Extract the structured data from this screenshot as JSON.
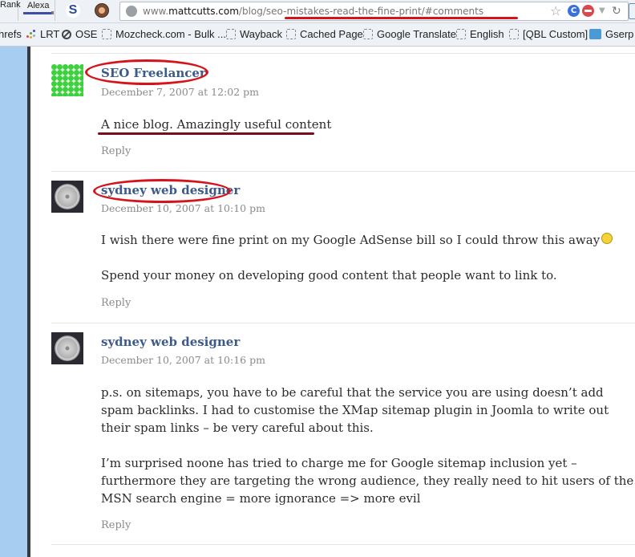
{
  "browser": {
    "extensions": {
      "rank_label": "Rank",
      "alexa_label": "Alexa",
      "s_icon_label": "S"
    },
    "url": {
      "prefix": "www.",
      "domain": "mattcutts.com",
      "path": "/blog/seo-mistakes-read-the-fine-print/#comments"
    },
    "g_icon_label": "C",
    "bookmarks": [
      {
        "label": "hrefs",
        "icon": "none"
      },
      {
        "label": "LRT",
        "icon": "lrt-icon"
      },
      {
        "label": "OSE",
        "icon": "ose-icon"
      },
      {
        "label": "Mozcheck.com - Bulk ...",
        "icon": "folder-icon"
      },
      {
        "label": "Wayback",
        "icon": "folder-icon"
      },
      {
        "label": "Cached Page",
        "icon": "folder-icon"
      },
      {
        "label": "Google Translate",
        "icon": "folder-icon"
      },
      {
        "label": "English",
        "icon": "folder-icon"
      },
      {
        "label": "[QBL Custom]",
        "icon": "folder-icon"
      },
      {
        "label": "Gserp",
        "icon": "gserp-icon"
      }
    ]
  },
  "comments": [
    {
      "author": "SEO Freelancer",
      "date": "December 7, 2007 at 12:02 pm",
      "paragraphs": [
        "A nice blog. Amazingly useful content"
      ],
      "reply_label": "Reply",
      "avatar": "green-identicon"
    },
    {
      "author": "sydney web designer",
      "date": "December 10, 2007 at 10:10 pm",
      "paragraphs": [
        "I wish there were fine print on my Google AdSense bill so I could throw this away",
        "Spend your money on developing good content that people want to link to."
      ],
      "reply_label": "Reply",
      "avatar": "wheel-photo"
    },
    {
      "author": "sydney web designer",
      "date": "December 10, 2007 at 10:16 pm",
      "paragraphs": [
        "p.s. on sitemaps, you have to be careful that the service you are using doesn’t add spam backlinks. I had to customise the XMap sitemap plugin in Joomla to write out their spam links – be very careful about this.",
        "I’m surprised noone has tried to charge me for Google sitemap inclusion yet – furthermore they are targeting the wrong audience, they really need to hit users of the MSN search engine = more ignorance => more evil"
      ],
      "reply_label": "Reply",
      "avatar": "wheel-photo"
    }
  ],
  "colors": {
    "annotation_red": "#d4141a",
    "annotation_dark_red": "#7a0c1e",
    "author_link": "#3c5a8a"
  }
}
